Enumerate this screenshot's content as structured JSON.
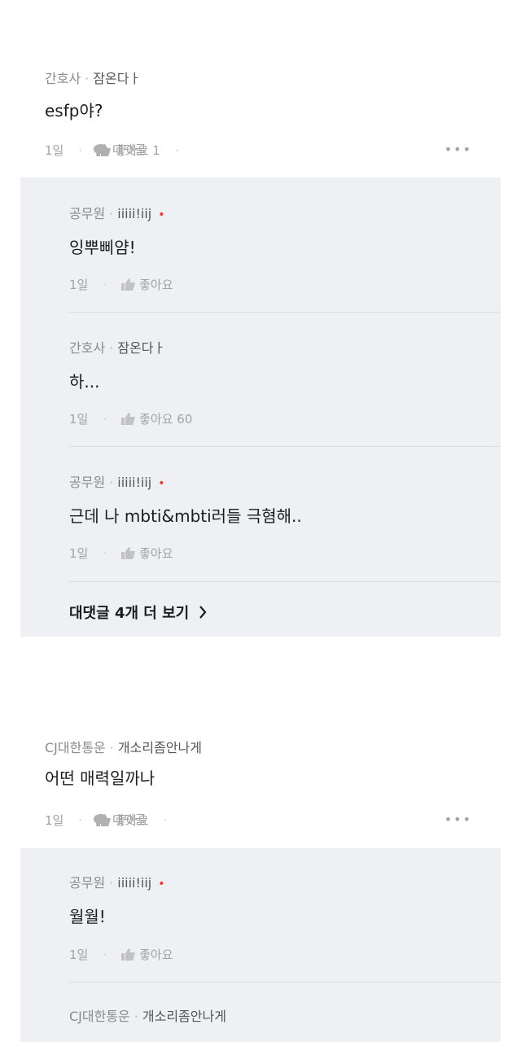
{
  "comments": [
    {
      "author": "간호사",
      "nickname": "잠온다ㅏ",
      "text": "esfp야?",
      "time": "1일",
      "like_label": "좋아요 1",
      "reply_label": "대댓글",
      "more": "•••",
      "replies": [
        {
          "author": "공무원",
          "nickname": "iiiii!iij",
          "badge": "•",
          "text": "잉뿌삐얌!",
          "time": "1일",
          "like_label": "좋아요"
        },
        {
          "author": "간호사",
          "nickname": "잠온다ㅏ",
          "text": "하...",
          "time": "1일",
          "like_label": "좋아요 60"
        },
        {
          "author": "공무원",
          "nickname": "iiiii!iij",
          "badge": "•",
          "text": "근데 나 mbti&mbti러들 극혐해..",
          "time": "1일",
          "like_label": "좋아요"
        }
      ],
      "more_replies_label": "대댓글 4개 더 보기"
    },
    {
      "author": "CJ대한통운",
      "nickname": "개소리좀안나게",
      "text": "어떤 매력일까나",
      "time": "1일",
      "like_label": "좋아요",
      "reply_label": "대댓글",
      "more": "•••",
      "replies": [
        {
          "author": "공무원",
          "nickname": "iiiii!iij",
          "badge": "•",
          "text": "월월!",
          "time": "1일",
          "like_label": "좋아요"
        },
        {
          "author": "CJ대한통운",
          "nickname": "개소리좀안나게"
        }
      ]
    }
  ],
  "separator": "·",
  "icons": {
    "like": "thumbs-up-icon",
    "reply": "speech-bubble-icon",
    "chevron": "chevron-right-icon",
    "badge_color": "#e03a3a"
  }
}
